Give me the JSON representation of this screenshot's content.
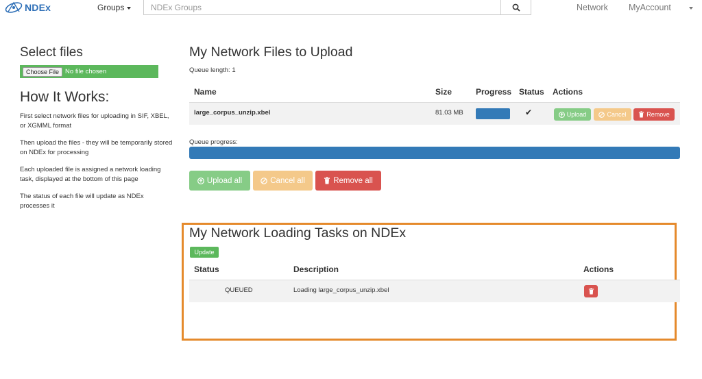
{
  "navbar": {
    "brand": "NDEx",
    "groups_label": "Groups",
    "search_placeholder": "NDEx Groups",
    "network_label": "Network",
    "myaccount_label": "MyAccount"
  },
  "sidebar": {
    "select_title": "Select files",
    "choose_file_label": "Choose File",
    "no_file_label": "No file chosen",
    "how_title": "How It Works:",
    "steps": [
      "First select network files for uploading in SIF, XBEL, or XGMML format",
      "Then upload the files - they will be temporarily stored on NDEx for processing",
      "Each uploaded file is assigned a network loading task, displayed at the bottom of this page",
      "The status of each file will update as NDEx processes it"
    ]
  },
  "upload": {
    "title": "My Network Files to Upload",
    "queue_length": "Queue length: 1",
    "columns": [
      "Name",
      "Size",
      "Progress",
      "Status",
      "Actions"
    ],
    "files": [
      {
        "name": "large_corpus_unzip.xbel",
        "size": "81.03 MB",
        "progress": 1.0,
        "status_icon": "check-icon"
      }
    ],
    "row_actions": {
      "upload": "Upload",
      "cancel": "Cancel",
      "remove": "Remove"
    },
    "queue_progress_label": "Queue progress:",
    "queue_progress": 1.0,
    "bulk_actions": {
      "upload_all": "Upload all",
      "cancel_all": "Cancel all",
      "remove_all": "Remove all"
    }
  },
  "tasks": {
    "title": "My Network Loading Tasks on NDEx",
    "update_label": "Update",
    "columns": [
      "Status",
      "Description",
      "Actions"
    ],
    "rows": [
      {
        "status": "QUEUED",
        "description": "Loading large_corpus_unzip.xbel"
      }
    ]
  },
  "colors": {
    "primary": "#337ab7",
    "success": "#5cb85c",
    "warning": "#f0ad4e",
    "danger": "#d9534f",
    "highlight_border": "#e58a2c"
  }
}
